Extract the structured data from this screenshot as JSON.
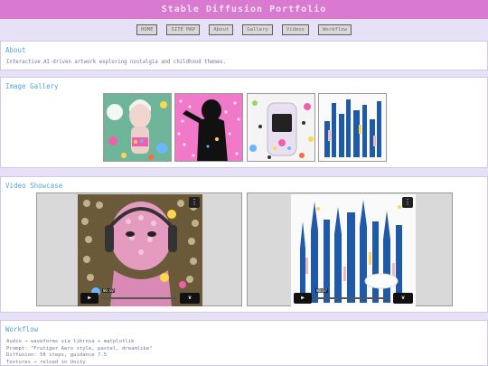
{
  "header": {
    "title": "Stable Diffusion Portfolio"
  },
  "nav": {
    "items": [
      "HOME",
      "SITE MAP",
      "About",
      "Gallery",
      "Videos",
      "Workflow"
    ]
  },
  "about": {
    "title": "About",
    "description": "Interactive AI-driven artwork exploring nostalgia and childhood themes."
  },
  "gallery": {
    "title": "Image Gallery"
  },
  "videos": {
    "title": "Video Showcase",
    "items": [
      {
        "time": "00:07",
        "menu_icon": "ellipsis-icon",
        "play_icon": "play-icon",
        "logo": "v"
      },
      {
        "time": "00:07",
        "menu_icon": "ellipsis-icon",
        "play_icon": "play-icon",
        "logo": "v"
      }
    ]
  },
  "workflow": {
    "title": "Workflow",
    "lines": [
      "Audio → waveforms via librosa + matplotlib",
      "Prompt: \"Frutiger Aero style, pastel, dreamlike\"",
      "Diffusion: 50 steps, guidance 7.5",
      "Textures → reload in Unity"
    ]
  },
  "colors": {
    "header": "#d97ad0",
    "background": "#e6e1f6",
    "section_title": "#55a6d0"
  }
}
